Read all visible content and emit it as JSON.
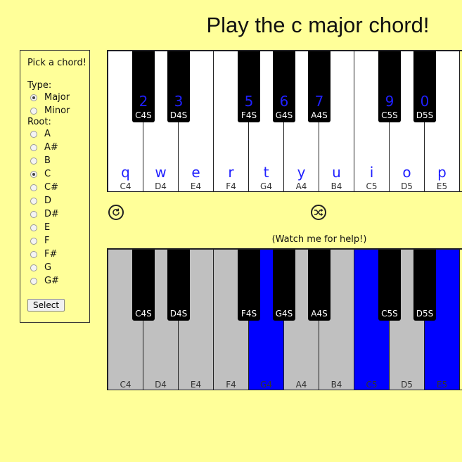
{
  "title": "Play the c major chord!",
  "panel": {
    "heading": "Pick a chord!",
    "type_label": "Type:",
    "types": [
      {
        "label": "Major",
        "checked": true
      },
      {
        "label": "Minor",
        "checked": false
      }
    ],
    "root_label": "Root:",
    "roots": [
      {
        "label": "A",
        "checked": false
      },
      {
        "label": "A#",
        "checked": false
      },
      {
        "label": "B",
        "checked": false
      },
      {
        "label": "C",
        "checked": true
      },
      {
        "label": "C#",
        "checked": false
      },
      {
        "label": "D",
        "checked": false
      },
      {
        "label": "D#",
        "checked": false
      },
      {
        "label": "E",
        "checked": false
      },
      {
        "label": "F",
        "checked": false
      },
      {
        "label": "F#",
        "checked": false
      },
      {
        "label": "G",
        "checked": false
      },
      {
        "label": "G#",
        "checked": false
      }
    ],
    "select_label": "Select"
  },
  "top_piano": {
    "white_keys": [
      {
        "hotkey": "q",
        "note": "C4"
      },
      {
        "hotkey": "w",
        "note": "D4"
      },
      {
        "hotkey": "e",
        "note": "E4"
      },
      {
        "hotkey": "r",
        "note": "F4"
      },
      {
        "hotkey": "t",
        "note": "G4"
      },
      {
        "hotkey": "y",
        "note": "A4"
      },
      {
        "hotkey": "u",
        "note": "B4"
      },
      {
        "hotkey": "i",
        "note": "C5"
      },
      {
        "hotkey": "o",
        "note": "D5"
      },
      {
        "hotkey": "p",
        "note": "E5"
      }
    ],
    "black_keys": [
      {
        "hotkey": "2",
        "note": "C4S"
      },
      {
        "hotkey": "3",
        "note": "D4S"
      },
      {
        "hotkey": "5",
        "note": "F4S"
      },
      {
        "hotkey": "6",
        "note": "G4S"
      },
      {
        "hotkey": "7",
        "note": "A4S"
      },
      {
        "hotkey": "9",
        "note": "C5S"
      },
      {
        "hotkey": "0",
        "note": "D5S"
      }
    ]
  },
  "controls": {
    "replay_icon": "replay-icon",
    "shuffle_icon": "shuffle-icon"
  },
  "help_text": "(Watch me for help!)",
  "bottom_piano": {
    "white_keys": [
      {
        "note": "C4",
        "lit": false
      },
      {
        "note": "D4",
        "lit": false
      },
      {
        "note": "E4",
        "lit": false
      },
      {
        "note": "F4",
        "lit": false
      },
      {
        "note": "G4",
        "lit": true
      },
      {
        "note": "A4",
        "lit": false
      },
      {
        "note": "B4",
        "lit": false
      },
      {
        "note": "C5",
        "lit": true
      },
      {
        "note": "D5",
        "lit": false
      },
      {
        "note": "E5",
        "lit": true
      }
    ],
    "black_keys": [
      {
        "note": "C4S"
      },
      {
        "note": "D4S"
      },
      {
        "note": "F4S"
      },
      {
        "note": "G4S"
      },
      {
        "note": "A4S"
      },
      {
        "note": "C5S"
      },
      {
        "note": "D5S"
      }
    ]
  },
  "colors": {
    "background": "#ffff99",
    "hotkey": "#2020ff",
    "lit_key": "#0000ff",
    "inactive_key": "#c0c0c0"
  }
}
